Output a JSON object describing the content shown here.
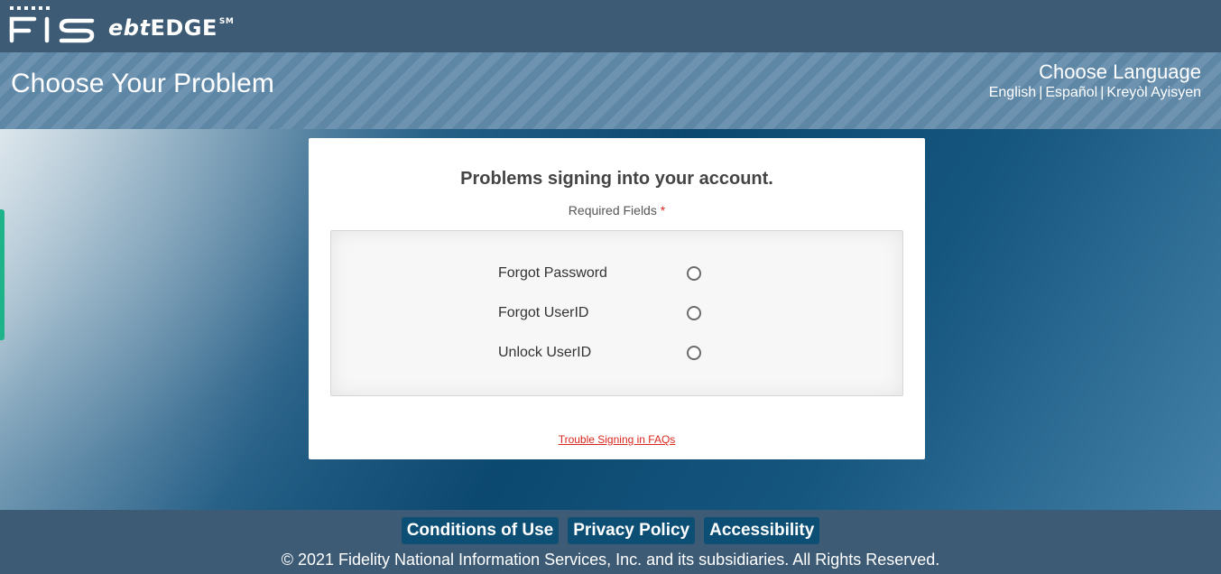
{
  "brand": {
    "company": "FIS",
    "product_prefix": "ebt",
    "product_suffix": "EDGE",
    "service_mark": "SM"
  },
  "header": {
    "page_title": "Choose Your Problem",
    "language_heading": "Choose Language",
    "languages": [
      "English",
      "Español",
      "Kreyòl Ayisyen"
    ],
    "separator": "|"
  },
  "card": {
    "title": "Problems signing into your account.",
    "required_label": "Required Fields",
    "required_marker": "*",
    "options": [
      {
        "label": "Forgot Password",
        "selected": false
      },
      {
        "label": "Forgot UserID",
        "selected": false
      },
      {
        "label": "Unlock UserID",
        "selected": false
      }
    ],
    "faq_link": "Trouble Signing in FAQs"
  },
  "footer": {
    "links": [
      "Conditions of Use",
      "Privacy Policy",
      "Accessibility"
    ],
    "copyright": "© 2021 Fidelity National Information Services, Inc. and its subsidiaries. All Rights Reserved."
  },
  "colors": {
    "header_bg": "#3d5b75",
    "accent_red": "#d9261c",
    "footer_button": "#0c4e74",
    "side_tab": "#1fb38a"
  }
}
